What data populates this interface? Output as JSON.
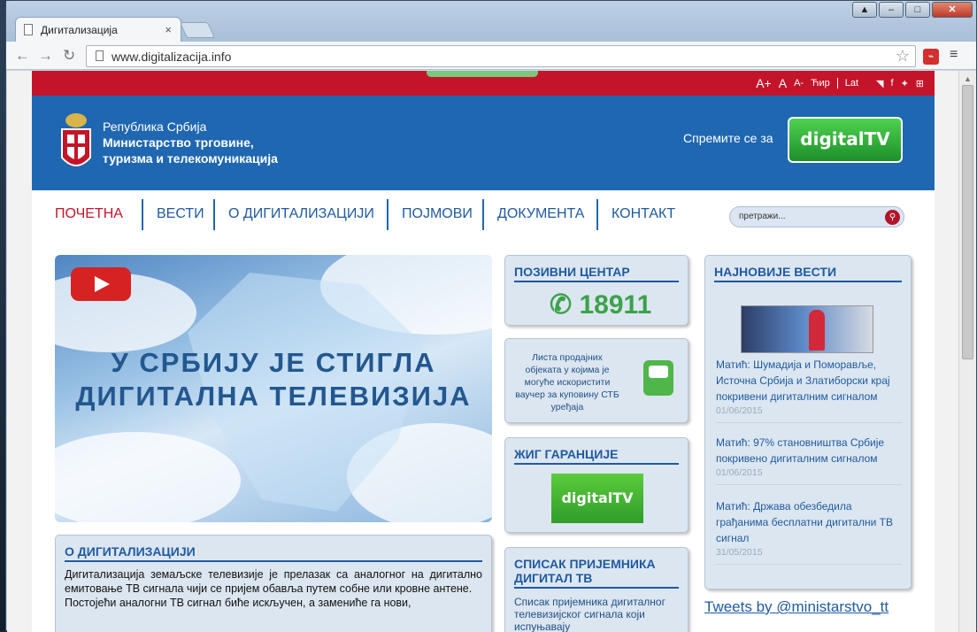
{
  "browser": {
    "tab_title": "Дигитализација",
    "url": "www.digitalizacija.info"
  },
  "utility": {
    "font_large": "A+",
    "font_medium": "A",
    "font_small": "A-",
    "cyr": "Ћир",
    "lat": "Lat",
    "icons": [
      "rss-icon",
      "facebook-icon",
      "twitter-icon",
      "sitemap-icon"
    ]
  },
  "header": {
    "line1": "Република Србија",
    "line2": "Министарство трговине,",
    "line3": "туризма и телекомуникација",
    "prepare": "Спремите се за",
    "dtv_logo": "digitalTV"
  },
  "nav": {
    "items": [
      "ПОЧЕТНА",
      "ВЕСТИ",
      "О ДИГИТАЛИЗАЦИЈИ",
      "ПОЈМОВИ",
      "ДОКУМЕНТА",
      "КОНТАКТ"
    ],
    "search_placeholder": "претражи..."
  },
  "hero": {
    "line1": "У СРБИЈУ ЈЕ СТИГЛА",
    "line2": "ДИГИТАЛНА ТЕЛЕВИЗИЈА"
  },
  "about": {
    "title": "О ДИГИТАЛИЗАЦИЈИ",
    "text1": "Дигитализација земаљске телевизије је прелазак са аналогног на дигитално емитовање ТВ сигнала чији се пријем обавља путем собне или кровне антене.",
    "text2": "Постојећи аналогни ТВ сигнал биће искључен, а замениће га нови,"
  },
  "call_center": {
    "title": "ПОЗИВНИ ЦЕНТАР",
    "number": "18911"
  },
  "list_box": {
    "text": "Листа продајних објеката у којима је могуће искористити ваучер за куповину СТБ уређаја"
  },
  "zig": {
    "title": "ЖИГ ГАРАНЦИЈЕ",
    "logo": "digitalTV"
  },
  "spisak": {
    "title": "СПИСАК ПРИЈЕМНИКА ДИГИТАЛ ТВ",
    "text": "Списак пријемника дигиталног телевизијског сигнала који испуњавају"
  },
  "news": {
    "title": "НАЈНОВИЈЕ ВЕСТИ",
    "items": [
      {
        "text": "Матић: Шумадија и Поморавље, Источна Србија и Златиборски крај покривени дигиталним сигналом",
        "date": "01/06/2015"
      },
      {
        "text": "Матић: 97% становништва Србије покривено дигиталним сигналом",
        "date": "01/06/2015"
      },
      {
        "text": "Матић: Држава обезбедила грађанима бесплатни дигитални ТВ сигнал",
        "date": "31/05/2015"
      }
    ]
  },
  "tweets": "Tweets by @ministarstvo_tt",
  "colors": {
    "red": "#c4142a",
    "blue": "#1f67b0",
    "green": "#3ca24a"
  }
}
